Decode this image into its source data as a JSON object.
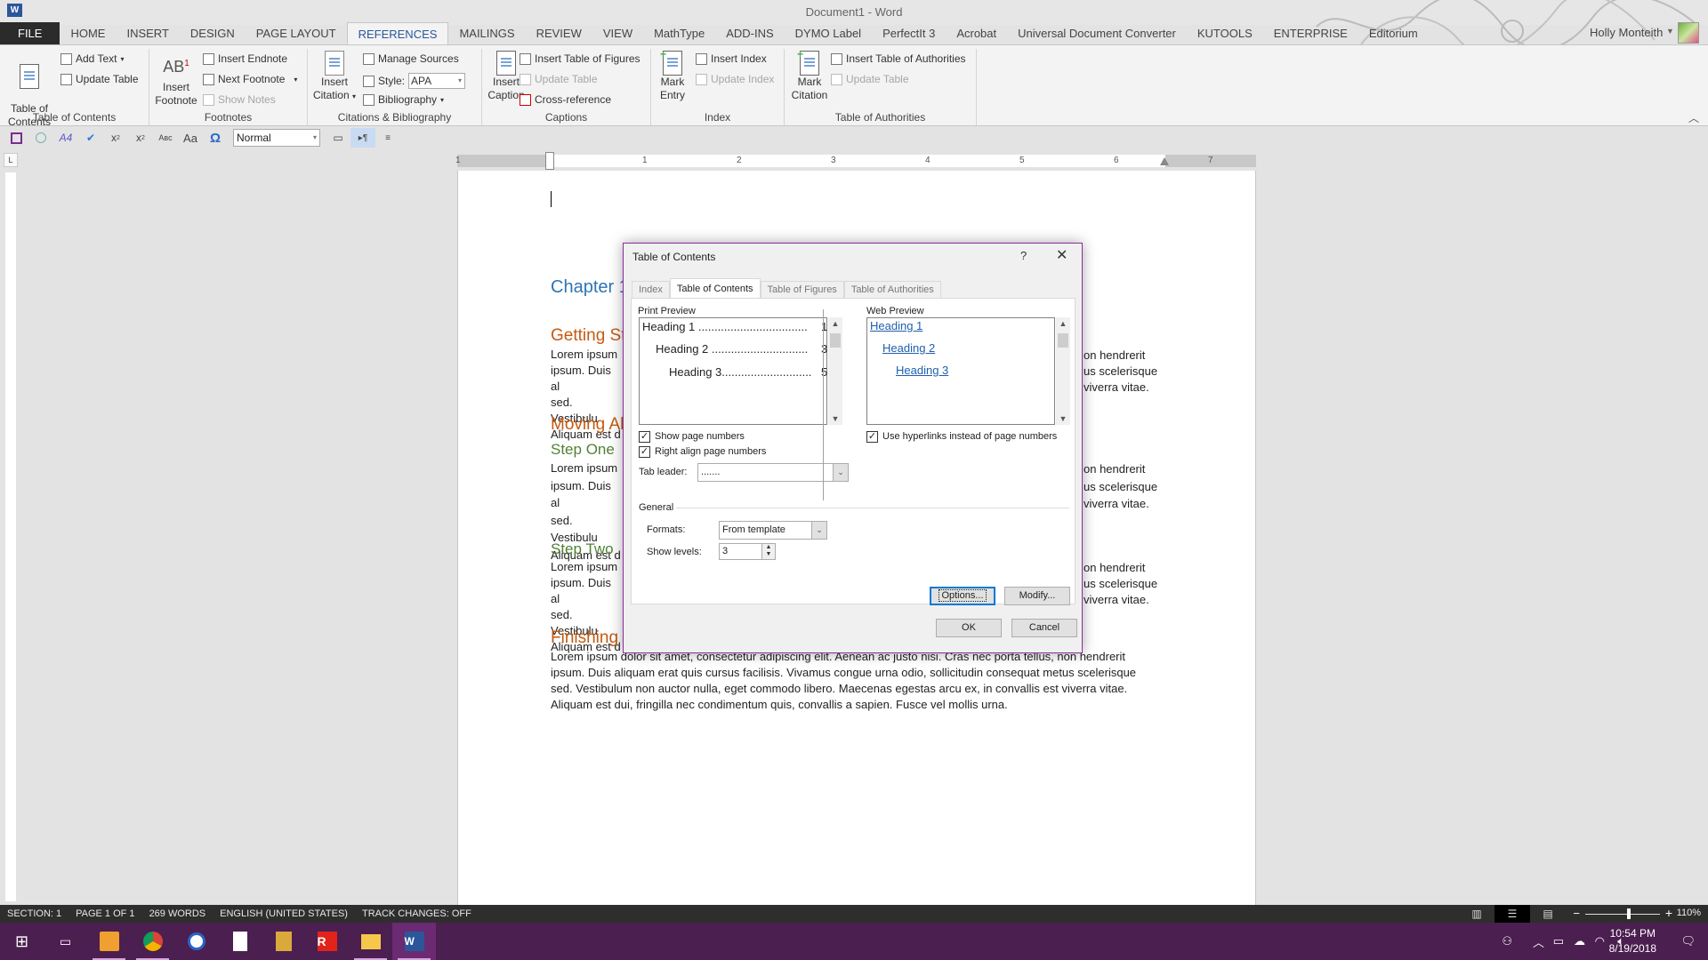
{
  "window": {
    "title": "Document1 - Word",
    "app_icon": "W"
  },
  "user": {
    "name": "Holly Monteith"
  },
  "tabs": [
    "FILE",
    "HOME",
    "INSERT",
    "DESIGN",
    "PAGE LAYOUT",
    "REFERENCES",
    "MAILINGS",
    "REVIEW",
    "VIEW",
    "MathType",
    "ADD-INS",
    "DYMO Label",
    "PerfectIt 3",
    "Acrobat",
    "Universal Document Converter",
    "KUTOOLS",
    "ENTERPRISE",
    "Editorium"
  ],
  "active_tab": "REFERENCES",
  "ribbon": {
    "toc": {
      "label": "Table of Contents",
      "big": "Table of\nContents",
      "add_text": "Add Text",
      "update_table": "Update Table"
    },
    "footnotes": {
      "label": "Footnotes",
      "insert_footnote_1": "Insert",
      "insert_footnote_2": "Footnote",
      "insert_endnote": "Insert Endnote",
      "next_footnote": "Next Footnote",
      "show_notes": "Show Notes"
    },
    "citations": {
      "label": "Citations & Bibliography",
      "insert_citation_1": "Insert",
      "insert_citation_2": "Citation",
      "manage_sources": "Manage Sources",
      "style_label": "Style:",
      "style_value": "APA",
      "bibliography": "Bibliography"
    },
    "captions": {
      "label": "Captions",
      "insert_caption_1": "Insert",
      "insert_caption_2": "Caption",
      "insert_tof": "Insert Table of Figures",
      "update_table": "Update Table",
      "cross_reference": "Cross-reference"
    },
    "index": {
      "label": "Index",
      "mark_entry_1": "Mark",
      "mark_entry_2": "Entry",
      "insert_index": "Insert Index",
      "update_index": "Update Index"
    },
    "toa": {
      "label": "Table of Authorities",
      "mark_citation_1": "Mark",
      "mark_citation_2": "Citation",
      "insert_toa": "Insert Table of Authorities",
      "update_table": "Update Table"
    }
  },
  "qat": {
    "style_value": "Normal",
    "icons": [
      "save-icon",
      "circle-icon",
      "font-color-icon",
      "spelling-icon",
      "subscript-icon",
      "superscript-icon",
      "small-caps-icon",
      "change-case-icon",
      "symbol-icon"
    ]
  },
  "ruler": {
    "numbers": [
      "1",
      "1",
      "2",
      "3",
      "4",
      "5",
      "6",
      "7"
    ]
  },
  "document": {
    "chapter": "Chapter 1",
    "h_getting": "Getting St",
    "h_moving": "Moving Ah",
    "h_step_one": "Step One",
    "h_step_two": "Step Two",
    "h_finishing": "Finishing u",
    "para_left_lines": [
      "Lorem ipsum",
      "ipsum. Duis al",
      "sed. Vestibulu",
      "Aliquam est d"
    ],
    "para_right_lines": [
      "on hendrerit",
      "us scelerisque",
      "viverra vitae."
    ],
    "final_paragraph": "Lorem ipsum dolor sit amet, consectetur adipiscing elit. Aenean ac justo nisi. Cras nec porta tellus, non hendrerit ipsum. Duis aliquam erat quis cursus facilisis. Vivamus congue urna odio, sollicitudin consequat metus scelerisque sed. Vestibulum non auctor nulla, eget commodo libero. Maecenas egestas arcu ex, in convallis est viverra vitae. Aliquam est dui, fringilla nec condimentum quis, convallis a sapien. Fusce vel mollis urna."
  },
  "dialog": {
    "title": "Table of Contents",
    "help": "?",
    "close": "✕",
    "tabs": [
      "Index",
      "Table of Contents",
      "Table of Figures",
      "Table of Authorities"
    ],
    "active_tab": "Table of Contents",
    "print_preview_label": "Print Preview",
    "print_preview": [
      {
        "text": "Heading 1",
        "page": "1"
      },
      {
        "text": "Heading 2",
        "page": "3"
      },
      {
        "text": "Heading 3",
        "page": "5"
      }
    ],
    "web_preview_label": "Web Preview",
    "web_preview": [
      "Heading 1",
      "Heading 2",
      "Heading 3"
    ],
    "show_page_numbers": {
      "label": "Show page numbers",
      "checked": true
    },
    "right_align": {
      "label": "Right align page numbers",
      "checked": true
    },
    "use_hyperlinks": {
      "label": "Use hyperlinks instead of page numbers",
      "checked": true
    },
    "tab_leader_label": "Tab leader:",
    "tab_leader_value": ".......",
    "general_label": "General",
    "formats_label": "Formats:",
    "formats_value": "From template",
    "show_levels_label": "Show levels:",
    "show_levels_value": "3",
    "options_button": "Options...",
    "modify_button": "Modify...",
    "ok_button": "OK",
    "cancel_button": "Cancel"
  },
  "statusbar": {
    "section": "SECTION: 1",
    "page": "PAGE 1 OF 1",
    "words": "269 WORDS",
    "language": "ENGLISH (UNITED STATES)",
    "track_changes": "TRACK CHANGES: OFF",
    "zoom": "110%"
  },
  "taskbar": {
    "time": "10:54 PM",
    "date": "8/19/2018"
  }
}
